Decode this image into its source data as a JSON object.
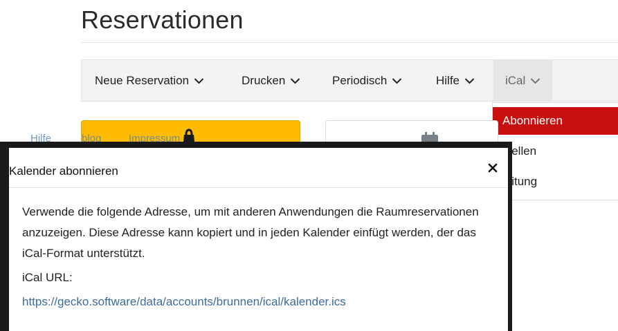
{
  "page": {
    "title": "Reservationen"
  },
  "nav": {
    "items": [
      {
        "label": "Neue Reservation",
        "icon": "chevron-down-icon"
      },
      {
        "label": "Drucken",
        "icon": "chevron-down-icon"
      },
      {
        "label": "Periodisch",
        "icon": "chevron-down-icon"
      },
      {
        "label": "Hilfe",
        "icon": "chevron-down-icon"
      },
      {
        "label": "iCal",
        "icon": "chevron-down-icon",
        "active": true
      }
    ]
  },
  "dropdown": {
    "items": [
      {
        "label": "Abonnieren",
        "selected": true
      },
      {
        "label": "stellen"
      },
      {
        "label": "leitung"
      }
    ]
  },
  "footer_links": {
    "hilfe": "Hilfe",
    "blog": "blog",
    "impressum": "Impressum"
  },
  "modal": {
    "title": "Kalender abonnieren",
    "close_glyph": "×",
    "body": "Verwende die folgende Adresse, um mit anderen Anwendungen die Raumreservationen anzuzeigen. Diese Adresse kann kopiert und in jeden Kalender einfügt werden, der das iCal-Format unterstützt.",
    "ical_label": "iCal URL:",
    "ical_url": "https://gecko.software/data/accounts/brunnen/ical/kalender.ics"
  },
  "colors": {
    "accent_red": "#c80e0e",
    "tile_yellow": "#ffbb00",
    "link_blue": "#3c6d9b",
    "modal_border": "#1a1a1a"
  }
}
